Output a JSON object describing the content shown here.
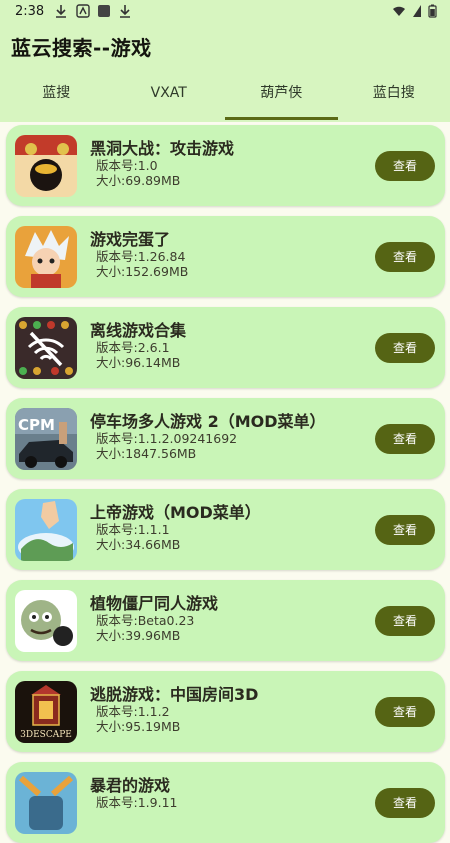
{
  "status": {
    "time": "2:38"
  },
  "app": {
    "title": "蓝云搜索--游戏"
  },
  "tabs": [
    {
      "label": "蓝搜"
    },
    {
      "label": "VXAT"
    },
    {
      "label": "葫芦侠"
    },
    {
      "label": "蓝白搜"
    }
  ],
  "items": [
    {
      "name": "黑洞大战：攻击游戏",
      "version": "版本号:1.0",
      "size": "大小:69.89MB",
      "button": "查看",
      "icon": "black-hole-game-icon"
    },
    {
      "name": "游戏完蛋了",
      "version": "版本号:1.26.84",
      "size": "大小:152.69MB",
      "button": "查看",
      "icon": "anime-hero-icon"
    },
    {
      "name": "离线游戏合集",
      "version": "版本号:2.6.1",
      "size": "大小:96.14MB",
      "button": "查看",
      "icon": "wifi-off-icon"
    },
    {
      "name": "停车场多人游戏 2（MOD菜单）",
      "version": "版本号:1.1.2.09241692",
      "size": "大小:1847.56MB",
      "button": "查看",
      "icon": "cpm-car-icon"
    },
    {
      "name": "上帝游戏（MOD菜单）",
      "version": "版本号:1.1.1",
      "size": "大小:34.66MB",
      "button": "查看",
      "icon": "god-hand-icon"
    },
    {
      "name": "植物僵尸同人游戏",
      "version": "版本号:Beta0.23",
      "size": "大小:39.96MB",
      "button": "查看",
      "icon": "zombie-icon"
    },
    {
      "name": "逃脱游戏：中国房间3D",
      "version": "版本号:1.1.2",
      "size": "大小:95.19MB",
      "button": "查看",
      "icon": "3d-escape-icon",
      "icon_text": "3DESCAPE"
    },
    {
      "name": "暴君的游戏",
      "version": "版本号:1.9.11",
      "size": "",
      "button": "查看",
      "icon": "tyrant-icon"
    }
  ]
}
